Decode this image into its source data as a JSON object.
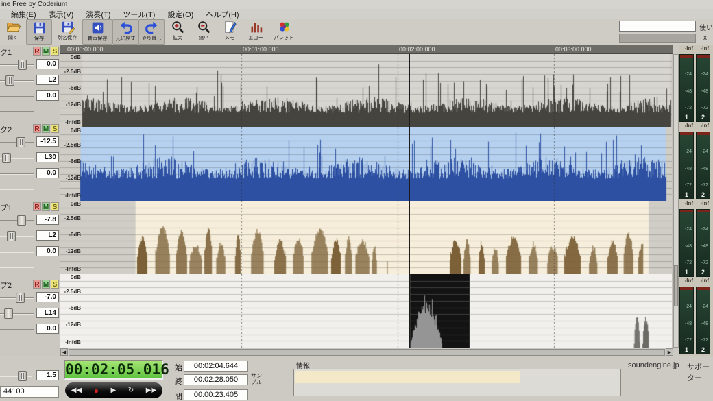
{
  "window": {
    "title": "ine Free by Coderium"
  },
  "menu": [
    "編集(E)",
    "表示(V)",
    "演奏(T)",
    "ツール(T)",
    "設定(O)",
    "ヘルプ(H)"
  ],
  "toolbar": [
    {
      "label": "開く",
      "icon": "open-folder-icon",
      "pressed": false
    },
    {
      "label": "保存",
      "icon": "save-floppy-icon",
      "pressed": true
    },
    {
      "label": "別名保存",
      "icon": "save-as-floppy-icon",
      "pressed": false
    },
    {
      "label": "音声保存",
      "icon": "audio-save-speaker-icon",
      "pressed": true
    },
    {
      "label": "元に戻す",
      "icon": "undo-arrow-icon",
      "pressed": true
    },
    {
      "label": "やり直し",
      "icon": "redo-arrow-icon",
      "pressed": true
    },
    {
      "label": "拡大",
      "icon": "zoom-in-icon",
      "pressed": false
    },
    {
      "label": "縮小",
      "icon": "zoom-out-icon",
      "pressed": false
    },
    {
      "label": "メモ",
      "icon": "memo-note-icon",
      "pressed": false
    },
    {
      "label": "エコー",
      "icon": "echo-bars-icon",
      "pressed": false
    },
    {
      "label": "パレット",
      "icon": "palette-icon",
      "pressed": false
    }
  ],
  "topright": {
    "help": "使い",
    "close": "x"
  },
  "ruler": [
    "00:00:00.000",
    "00:01:00.000",
    "00:02:00.000",
    "00:03:00.000"
  ],
  "db_scale": [
    "0dB",
    "-2.5dB",
    "-6dB",
    "-12dB",
    "-InfdB"
  ],
  "tracks": [
    {
      "label": "ク1",
      "rec": "R",
      "mute": "M",
      "solo": "S",
      "volume": "0.0",
      "pan": "L2",
      "extra": "0.0",
      "waveform": {
        "type": "dense",
        "bg": "#d7d5d0",
        "color": "#45443e",
        "start": 0.036,
        "end": 0.998,
        "base": 0.2,
        "var": 0.22,
        "peak": 0.7
      }
    },
    {
      "label": "ク2",
      "rec": "R",
      "mute": "M",
      "solo": "S",
      "volume": "-12.5",
      "pan": "L30",
      "extra": "0.0",
      "waveform": {
        "type": "dense",
        "bg": "#b5d1ef",
        "color": "#2d50a2",
        "start": 0.033,
        "end": 0.99,
        "base": 0.3,
        "var": 0.3,
        "peak": 0.84
      }
    },
    {
      "label": "プ1",
      "rec": "R",
      "mute": "M",
      "solo": "S",
      "volume": "-7.8",
      "pan": "L2",
      "extra": "0.0",
      "waveform": {
        "type": "bursts",
        "bg": "#f6eeda",
        "color": "#7c6138",
        "start": 0.123,
        "end": 0.962,
        "regions": [
          [
            0.126,
            0.535
          ],
          [
            0.637,
            0.953
          ]
        ],
        "base": 0.32,
        "peak": 0.62
      }
    },
    {
      "label": "プ2",
      "rec": "R",
      "mute": "M",
      "solo": "S",
      "volume": "-7.0",
      "pan": "L14",
      "extra": "0.0",
      "waveform": {
        "type": "selection",
        "bg": "#f2f0ec",
        "color": "#9c9c9c",
        "sel_bg": "#131313",
        "sel_start": 0.5717,
        "sel_end": 0.6693,
        "wave_end": 0.632,
        "spike_color": "#55544f",
        "spikes": [
          [
            0.938,
            0.947
          ],
          [
            0.952,
            0.962
          ]
        ]
      }
    }
  ],
  "timeline": {
    "minutes": [
      0.296,
      0.5516,
      0.807
    ],
    "cursor": 0.5706
  },
  "meters": {
    "peak": "-Inf",
    "scale": [
      "-24",
      "-48",
      "-72"
    ],
    "channels": [
      "1",
      "2"
    ]
  },
  "transport": {
    "display": "00:02:05.016"
  },
  "fields": {
    "start_label": "始",
    "start": "00:02:04.644",
    "end_label": "終",
    "end": "00:02:28.050",
    "gap_label": "間",
    "gap": "00:00:23.405",
    "sample": "サンプル"
  },
  "info": {
    "label": "情報"
  },
  "footer": {
    "site": "soundengine.jp",
    "supporter": "サポーター"
  },
  "misc": {
    "tempo": "1.5",
    "samplerate": "44100"
  },
  "colors": {
    "accent_blue": "#2d50a2",
    "track_brown": "#7c6138",
    "meter_green": "#1c3527",
    "lcd_green": "#6ec94a",
    "selection_black": "#131313",
    "active_track_border": "#da8a70"
  }
}
